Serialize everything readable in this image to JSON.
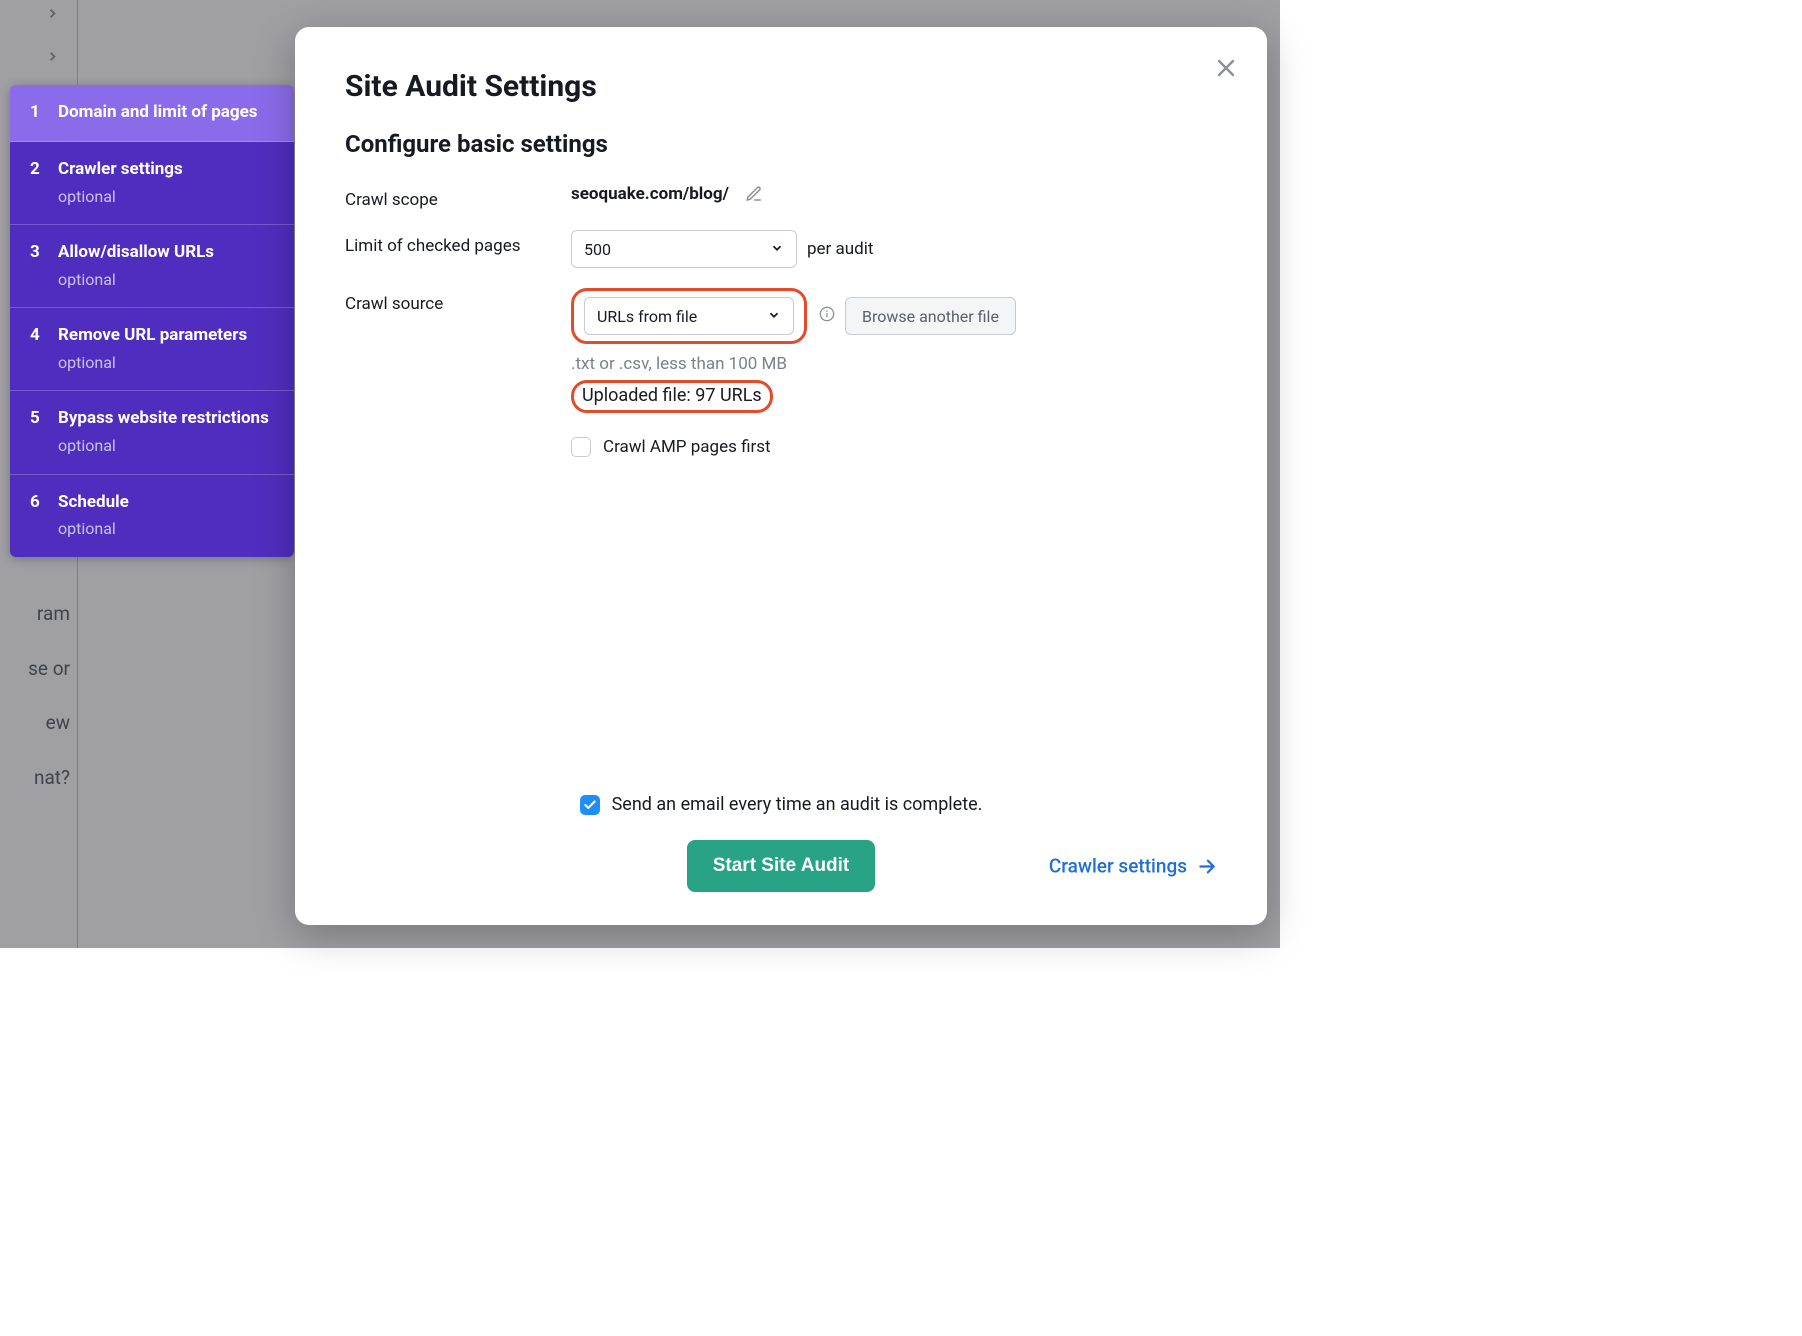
{
  "sidebar": {
    "steps": [
      {
        "num": "1",
        "title": "Domain and limit of pages",
        "optional": "",
        "active": true
      },
      {
        "num": "2",
        "title": "Crawler settings",
        "optional": "optional",
        "active": false
      },
      {
        "num": "3",
        "title": "Allow/disallow URLs",
        "optional": "optional",
        "active": false
      },
      {
        "num": "4",
        "title": "Remove URL parameters",
        "optional": "optional",
        "active": false
      },
      {
        "num": "5",
        "title": "Bypass website restrictions",
        "optional": "optional",
        "active": false
      },
      {
        "num": "6",
        "title": "Schedule",
        "optional": "optional",
        "active": false
      }
    ]
  },
  "modal": {
    "title": "Site Audit Settings",
    "section_title": "Configure basic settings",
    "crawl_scope_label": "Crawl scope",
    "crawl_scope_value": "seoquake.com/blog/",
    "limit_label": "Limit of checked pages",
    "limit_value": "500",
    "limit_suffix": "per audit",
    "crawl_source_label": "Crawl source",
    "crawl_source_value": "URLs from file",
    "browse_label": "Browse another file",
    "file_hint": ".txt or .csv, less than 100 MB",
    "uploaded_text": "Uploaded file: 97 URLs",
    "amp_label": "Crawl AMP pages first",
    "email_label": "Send an email every time an audit is complete.",
    "start_label": "Start Site Audit",
    "crawler_link": "Crawler settings"
  },
  "background": {
    "w1": "ram",
    "w2": "se or",
    "w3": "ew",
    "w4": "nat?"
  }
}
